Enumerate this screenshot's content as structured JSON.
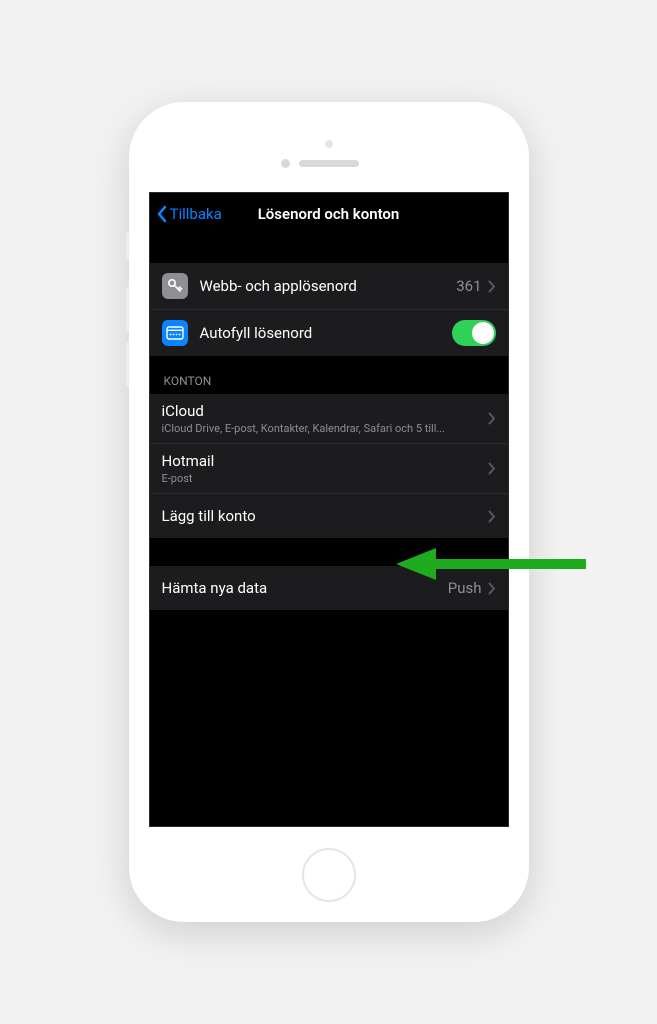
{
  "nav": {
    "back_label": "Tillbaka",
    "title": "Lösenord och konton"
  },
  "passwords": {
    "web_app_label": "Webb- och applösenord",
    "web_app_count": "361",
    "autofill_label": "Autofyll lösenord",
    "autofill_on": true
  },
  "accounts": {
    "header": "KONTON",
    "items": [
      {
        "title": "iCloud",
        "subtitle": "iCloud Drive, E-post, Kontakter, Kalendrar, Safari och 5 till..."
      },
      {
        "title": "Hotmail",
        "subtitle": "E-post"
      }
    ],
    "add_account_label": "Lägg till konto"
  },
  "fetch": {
    "label": "Hämta nya data",
    "value": "Push"
  }
}
